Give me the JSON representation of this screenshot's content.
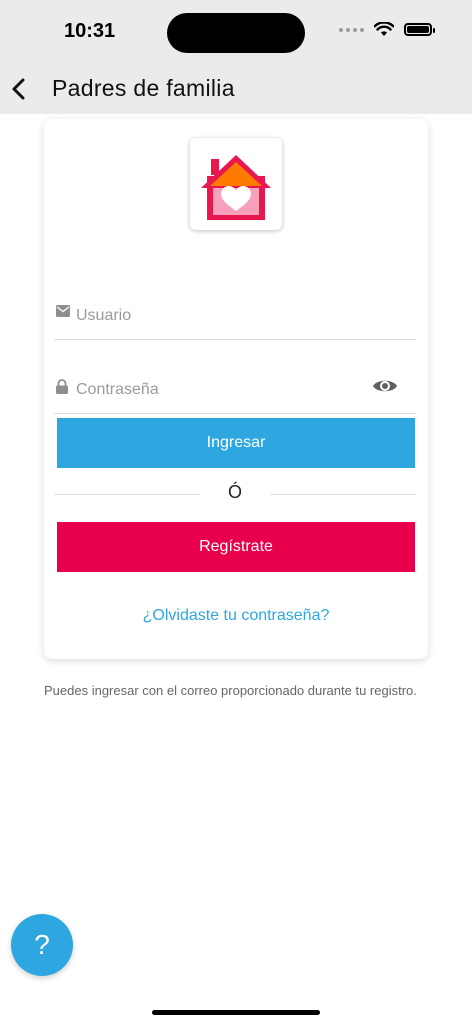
{
  "status_bar": {
    "time": "10:31"
  },
  "navbar": {
    "title": "Padres de familia"
  },
  "login": {
    "user_placeholder": "Usuario",
    "password_placeholder": "Contraseña",
    "login_label": "Ingresar",
    "or_label": "Ó",
    "register_label": "Regístrate",
    "forgot_label": "¿Olvidaste tu contraseña?"
  },
  "info_text": "Puedes ingresar con el correo proporcionado durante tu registro.",
  "help_label": "?",
  "colors": {
    "primary_blue": "#2ea7e0",
    "register_pink": "#e8004c",
    "logo_red": "#e8174f",
    "logo_orange": "#ff7b00"
  },
  "icons": [
    "chevron-left-icon",
    "wifi-icon",
    "battery-icon",
    "envelope-icon",
    "lock-icon",
    "eye-icon",
    "house-heart-logo"
  ]
}
